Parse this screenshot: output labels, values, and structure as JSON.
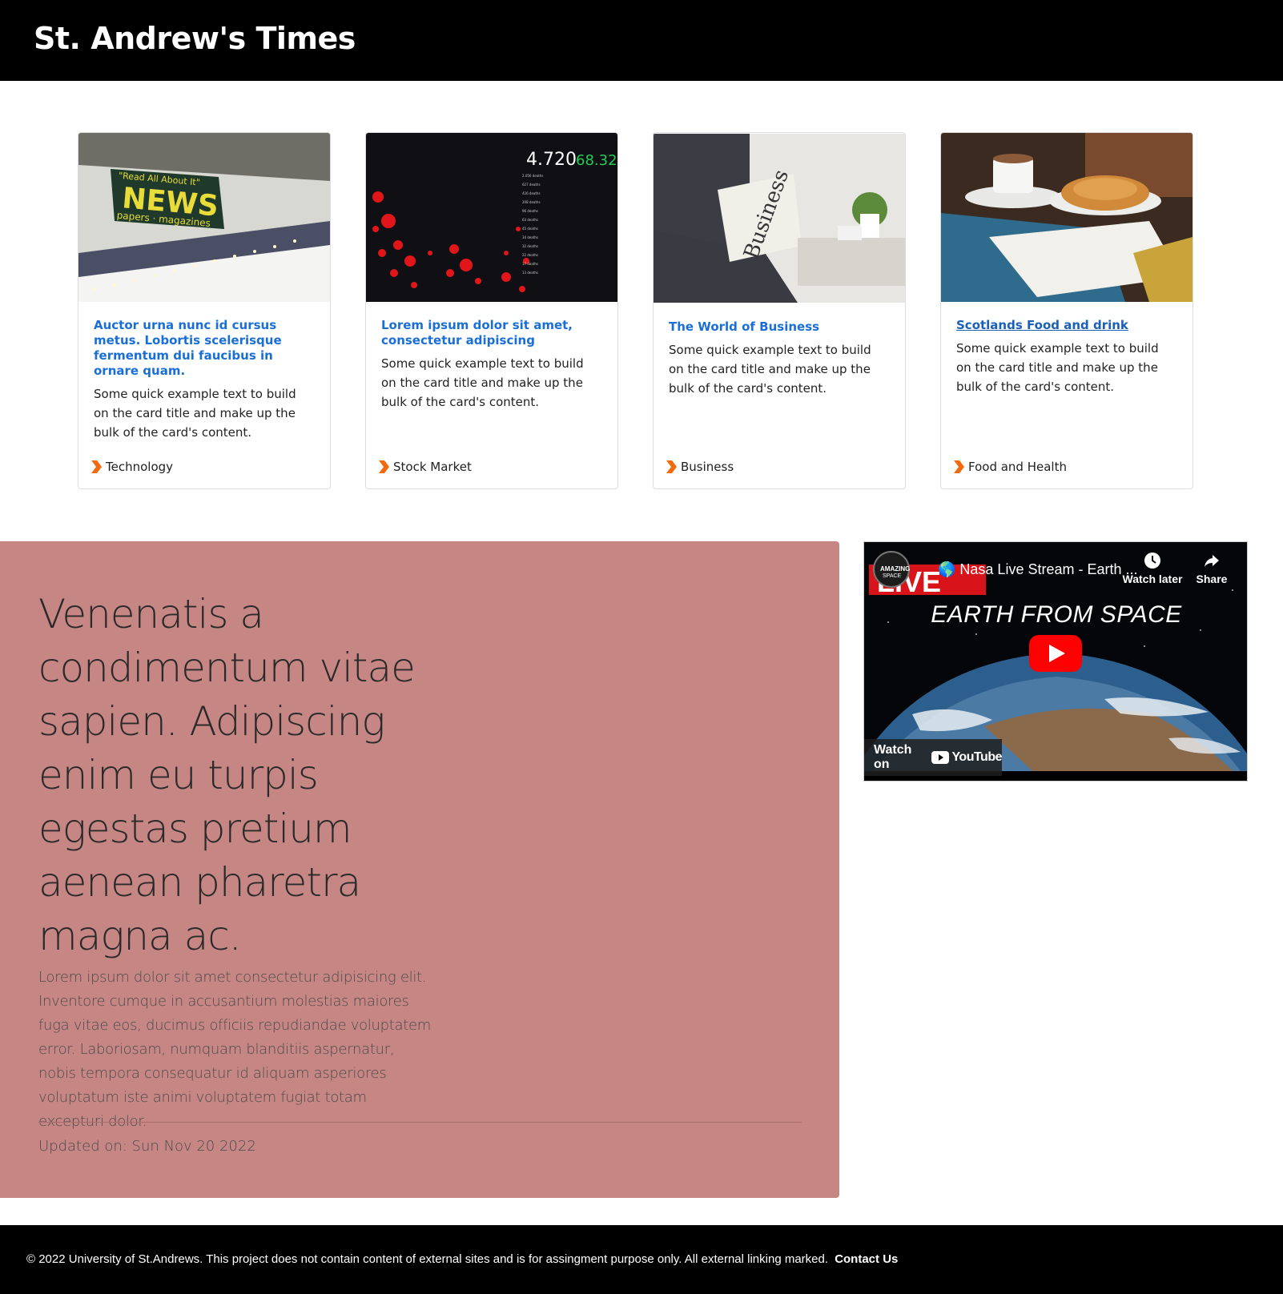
{
  "header": {
    "title": "St. Andrew's Times"
  },
  "cards": [
    {
      "title": "Auctor urna nunc id cursus metus. Lobortis scelerisque fermentum dui faucibus in ornare quam.",
      "text": "Some quick example text to build on the card title and make up the bulk of the card's content.",
      "category": "Technology",
      "image": "news-sign-photo"
    },
    {
      "title": "Lorem ipsum dolor sit amet, consectetur adipiscing",
      "text": "Some quick example text to build on the card title and make up the bulk of the card's content.",
      "category": "Stock Market",
      "image": "covid-dashboard-photo"
    },
    {
      "title": "The World of Business",
      "text": "Some quick example text to build on the card title and make up the bulk of the card's content.",
      "category": "Business",
      "image": "business-newspaper-photo"
    },
    {
      "title": "Scotlands Food and drink",
      "text": "Some quick example text to build on the card title and make up the bulk of the card's content.",
      "category": "Food and Health",
      "image": "coffee-croissant-photo"
    }
  ],
  "feature": {
    "lead": "Venenatis a condimentum vitae sapien. Adipiscing enim eu turpis egestas pretium aenean pharetra magna ac.",
    "paragraph": "Lorem ipsum dolor sit amet consectetur adipisicing elit. Inventore cumque in accusantium molestias maiores fuga vitae eos, ducimus officiis repudiandae voluptatem error. Laboriosam, numquam blanditiis aspernatur, nobis tempora consequatur id aliquam asperiores voluptatum iste animi voluptatem fugiat totam excepturi dolor.",
    "updated": "Updated on: Sun Nov 20 2022",
    "background_color": "#c68683"
  },
  "video": {
    "title": "🌎 Nasa Live Stream - Earth ...",
    "watch_later_label": "Watch later",
    "share_label": "Share",
    "overlay_text": "EARTH FROM SPACE",
    "badge_text": "LIVE",
    "watch_on_label": "Watch on",
    "youtube_label": "YouTube"
  },
  "footer": {
    "text": "© 2022 University of St.Andrews. This project does not contain content of external sites and is for assingment purpose only. All external linking marked.",
    "contact_label": "Contact Us"
  },
  "colors": {
    "header_bg": "#000000",
    "link_blue": "#1a6fd6",
    "chevron_orange": "#f26a0f",
    "youtube_red": "#ff0000"
  }
}
